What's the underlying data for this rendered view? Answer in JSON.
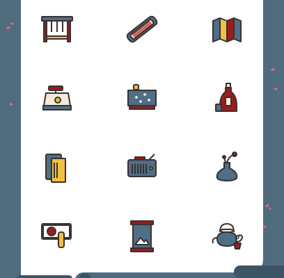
{
  "palette": {
    "background": "#4f6c7f",
    "card": "#ffffff",
    "outline": "#3a3030",
    "blue": "#4e6f86",
    "red": "#9b1c1c",
    "yellow": "#f0c040",
    "cream": "#f4ead8",
    "petal": "#e86a7a"
  },
  "icons": [
    {
      "row": 1,
      "col": 1,
      "name": "gong-rack-icon"
    },
    {
      "row": 1,
      "col": 2,
      "name": "guzheng-icon"
    },
    {
      "row": 1,
      "col": 3,
      "name": "folding-map-icon"
    },
    {
      "row": 2,
      "col": 1,
      "name": "ink-stone-icon"
    },
    {
      "row": 2,
      "col": 2,
      "name": "go-board-icon"
    },
    {
      "row": 2,
      "col": 3,
      "name": "wine-jar-icon"
    },
    {
      "row": 3,
      "col": 1,
      "name": "books-icon"
    },
    {
      "row": 3,
      "col": 2,
      "name": "radio-icon"
    },
    {
      "row": 3,
      "col": 3,
      "name": "flower-vase-icon"
    },
    {
      "row": 4,
      "col": 1,
      "name": "seal-stamp-icon"
    },
    {
      "row": 4,
      "col": 2,
      "name": "hourglass-icon"
    },
    {
      "row": 4,
      "col": 3,
      "name": "teapot-icon"
    }
  ]
}
